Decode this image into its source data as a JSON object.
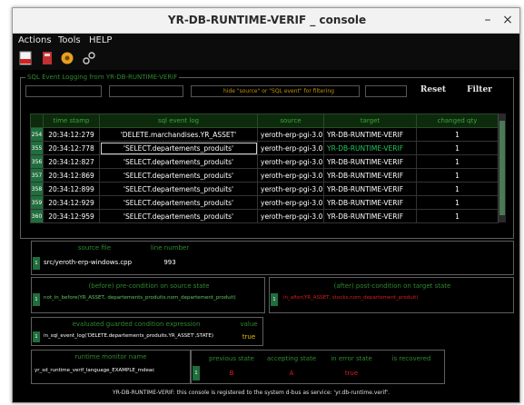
{
  "window": {
    "title": "YR-DB-RUNTIME-VERIF _ console",
    "minimize": "–",
    "close": "×"
  },
  "menu": {
    "actions": "Actions",
    "tools": "Tools",
    "help": "HELP"
  },
  "toolbar_icons": [
    "pdf-icon",
    "export-icon",
    "settings-icon",
    "connect-icon"
  ],
  "sql_logging": {
    "group_title": "SQL Event Logging from YR-DB-RUNTIME-VERIF",
    "filter_hint": "hide \"source\" or \"SQL event\" for filtering",
    "reset": "Reset",
    "filter": "Filter",
    "columns": [
      "time stamp",
      "sql event log",
      "source",
      "target",
      "changed qty"
    ],
    "rows": [
      {
        "num": "254",
        "time": "20:34:12:279",
        "query": "'DELETE.marchandises.YR_ASSET'",
        "source": "yeroth-erp-pgi-3.0",
        "target": "YR-DB-RUNTIME-VERIF",
        "qty": "1"
      },
      {
        "num": "355",
        "time": "20:34:12:778",
        "query": "'SELECT.departements_produits'",
        "source": "yeroth-erp-pgi-3.0",
        "target": "YR-DB-RUNTIME-VERIF",
        "qty": "1"
      },
      {
        "num": "356",
        "time": "20:34:12:827",
        "query": "'SELECT.departements_produits'",
        "source": "yeroth-erp-pgi-3.0",
        "target": "YR-DB-RUNTIME-VERIF",
        "qty": "1"
      },
      {
        "num": "357",
        "time": "20:34:12:869",
        "query": "'SELECT.departements_produits'",
        "source": "yeroth-erp-pgi-3.0",
        "target": "YR-DB-RUNTIME-VERIF",
        "qty": "1"
      },
      {
        "num": "358",
        "time": "20:34:12:899",
        "query": "'SELECT.departements_produits'",
        "source": "yeroth-erp-pgi-3.0",
        "target": "YR-DB-RUNTIME-VERIF",
        "qty": "1"
      },
      {
        "num": "359",
        "time": "20:34:12:929",
        "query": "'SELECT.departements_produits'",
        "source": "yeroth-erp-pgi-3.0",
        "target": "YR-DB-RUNTIME-VERIF",
        "qty": "1"
      },
      {
        "num": "360",
        "time": "20:34:12:959",
        "query": "'SELECT.departements_produits'",
        "source": "yeroth-erp-pgi-3.0",
        "target": "YR-DB-RUNTIME-VERIF",
        "qty": "1"
      }
    ]
  },
  "source_file": {
    "label_file": "source file",
    "label_line": "line number",
    "row_num": "1",
    "file": "src/yeroth-erp-windows.cpp",
    "line": "993"
  },
  "pre_condition": {
    "title": "(before) pre-condition on source state",
    "row_num": "1",
    "value": "not_in_before(YR_ASSET, departements_produits.nom_departement_produit)"
  },
  "post_condition": {
    "title": "(after) post-condition on target state",
    "row_num": "1",
    "value": "in_after(YR_ASSET, stocks.nom_departement_produit)"
  },
  "guard": {
    "title_expr": "evaluated guarded condition expression",
    "title_value": "value",
    "row_num": "1",
    "expr": "in_sql_event_log('DELETE.departements_produits.YR_ASSET',STATE)",
    "value": "true"
  },
  "monitor": {
    "title": "runtime monitor name",
    "name": "yr_sd_runtime_verif_language_EXAMPLE_mdeac",
    "columns": [
      "previous state",
      "accepting state",
      "in error state",
      "is recovered"
    ],
    "row_num": "1",
    "values": [
      "B",
      "A",
      "true",
      ""
    ]
  },
  "status_bar": "YR-DB-RUNTIME-VERIF: this console is registered to the system d-bus as service: 'yr.db-runtime.verif'.",
  "colors": {
    "accent_green": "#2e8b2e",
    "row_num_bg": "#1f6e3d",
    "warning_red": "#e11d1d",
    "hint_orange": "#c89000"
  }
}
